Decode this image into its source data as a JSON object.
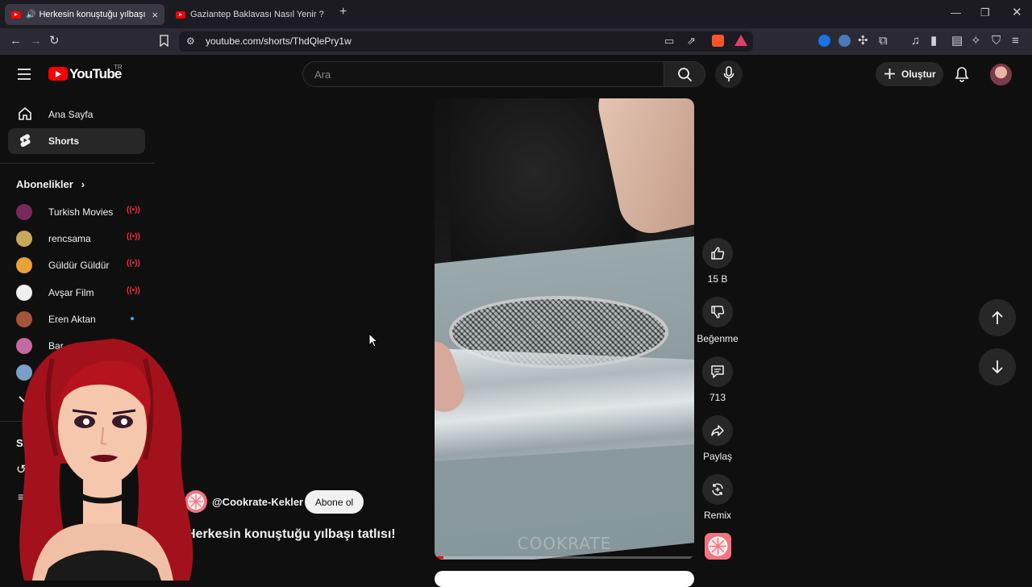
{
  "browser": {
    "tabs": [
      {
        "title": "Herkesin konuştuğu yılbaşı ta",
        "active": true
      },
      {
        "title": "Gaziantep Baklavası Nasıl Yenir ? - Ke",
        "active": false
      }
    ],
    "new_tab_icon": "plus-icon",
    "url": "youtube.com/shorts/ThdQlePry1w"
  },
  "header": {
    "logo_text": "YouTube",
    "logo_region": "TR",
    "search_placeholder": "Ara",
    "create_label": "Oluştur"
  },
  "sidebar": {
    "items": [
      {
        "label": "Ana Sayfa",
        "icon": "home-icon",
        "selected": false
      },
      {
        "label": "Shorts",
        "icon": "shorts-icon",
        "selected": true
      }
    ],
    "subscriptions_title": "Abonelikler",
    "subscriptions": [
      {
        "name": "Turkish Movies",
        "status": "live",
        "color": "#7a2a5a"
      },
      {
        "name": "rencsama",
        "status": "live",
        "color": "#c8a85a"
      },
      {
        "name": "Güldür Güldür",
        "status": "live",
        "color": "#e7a23a"
      },
      {
        "name": "Avşar Film",
        "status": "live",
        "color": "#f0f0f0"
      },
      {
        "name": "Eren Aktan",
        "status": "new",
        "color": "#a3553a"
      },
      {
        "name": "Bar",
        "status": "",
        "color": "#c26aa0"
      },
      {
        "name": "",
        "status": "",
        "color": "#7aa0c8"
      }
    ],
    "you_title": "Siz"
  },
  "short": {
    "watermark": "COOKRATE",
    "progress": 0.035,
    "channel_handle": "@Cookrate-Kekler",
    "subscribe_label": "Abone ol",
    "title": "Herkesin konuştuğu yılbaşı tatlısı!"
  },
  "actions": {
    "like_count": "15 B",
    "dislike_label": "Beğenme",
    "comment_count": "713",
    "share_label": "Paylaş",
    "remix_label": "Remix"
  },
  "colors": {
    "accent": "#ff0000",
    "background": "#0f0f0f",
    "surface": "#272727"
  }
}
